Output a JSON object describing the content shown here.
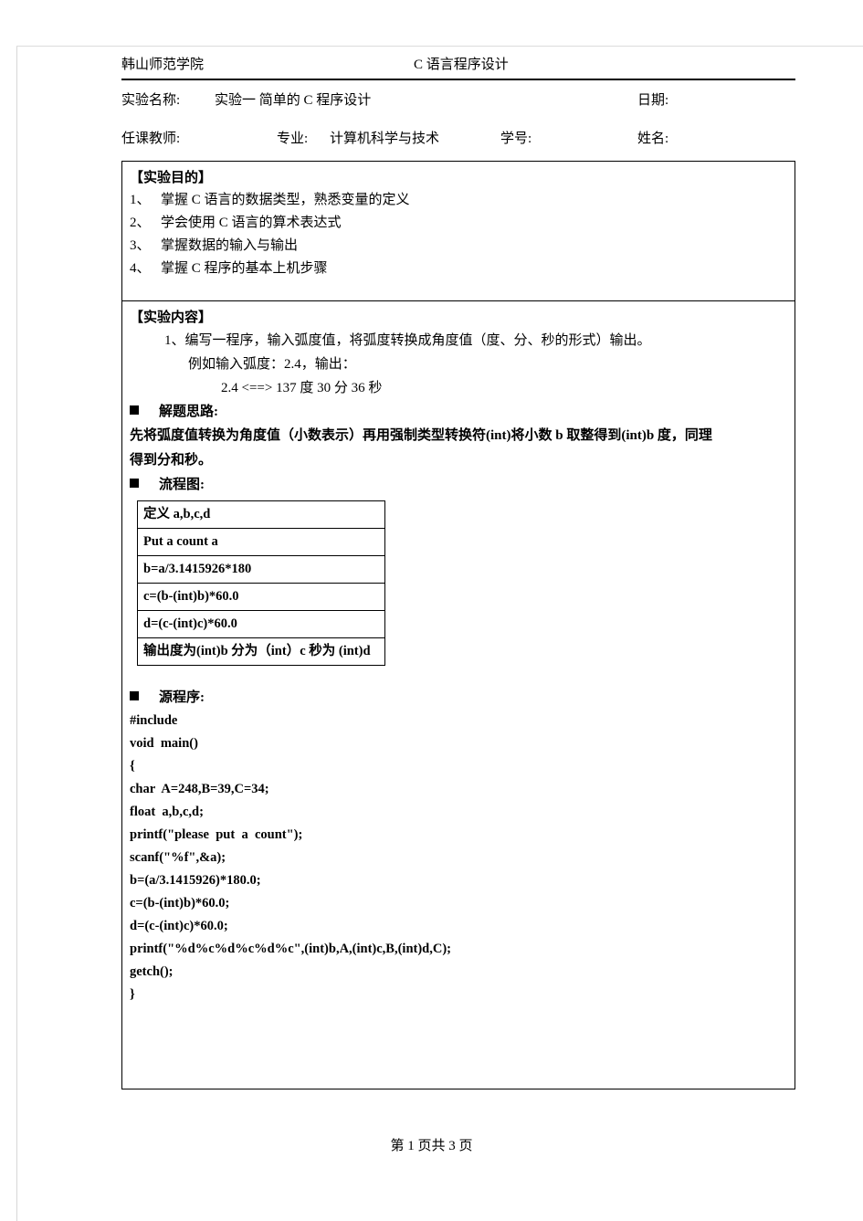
{
  "header": {
    "school": "韩山师范学院",
    "course": "C 语言程序设计"
  },
  "meta": {
    "lab_name_label": "实验名称:",
    "lab_name_value": "实验一  简单的 C 程序设计",
    "date_label": "日期:",
    "teacher_label": "任课教师:",
    "major_label": "专业:",
    "major_value": "计算机科学与技术",
    "student_id_label": "学号:",
    "name_label": "姓名:"
  },
  "purpose": {
    "title": "【实验目的】",
    "items": [
      {
        "num": "1、",
        "text": "掌握 C 语言的数据类型，熟悉变量的定义"
      },
      {
        "num": "2、",
        "text": "学会使用 C 语言的算术表达式"
      },
      {
        "num": "3、",
        "text": "掌握数据的输入与输出"
      },
      {
        "num": "4、",
        "text": "掌握 C 程序的基本上机步骤"
      }
    ]
  },
  "content": {
    "title": "【实验内容】",
    "task_line1": "1、编写一程序，输入弧度值，将弧度转换成角度值（度、分、秒的形式）输出。",
    "task_line2": "例如输入弧度：2.4，输出：",
    "task_example": "2.4 <==> 137 度 30 分 36 秒",
    "approach_heading": "解题思路:",
    "approach_line1": "先将弧度值转换为角度值（小数表示）再用强制类型转换符(int)将小数 b 取整得到(int)b 度，同理",
    "approach_line2": "得到分和秒。",
    "flowchart_heading": "流程图:",
    "flowchart_rows": [
      "定义 a,b,c,d",
      "Put  a  count  a",
      "b=a/3.1415926*180",
      "c=(b-(int)b)*60.0",
      "d=(c-(int)c)*60.0",
      "输出度为(int)b  分为（int）c  秒为 (int)d"
    ],
    "source_heading": "源程序:",
    "source_lines": [
      "#include",
      "void  main()",
      "{",
      "char  A=248,B=39,C=34;",
      "float  a,b,c,d;",
      "printf(\"please  put  a  count\");",
      "scanf(\"%f\",&a);",
      "b=(a/3.1415926)*180.0;",
      "c=(b-(int)b)*60.0;",
      "d=(c-(int)c)*60.0;",
      "printf(\"%d%c%d%c%d%c\",(int)b,A,(int)c,B,(int)d,C);",
      "getch();",
      "}"
    ]
  },
  "footer": {
    "text": "第 1 页共 3 页"
  }
}
